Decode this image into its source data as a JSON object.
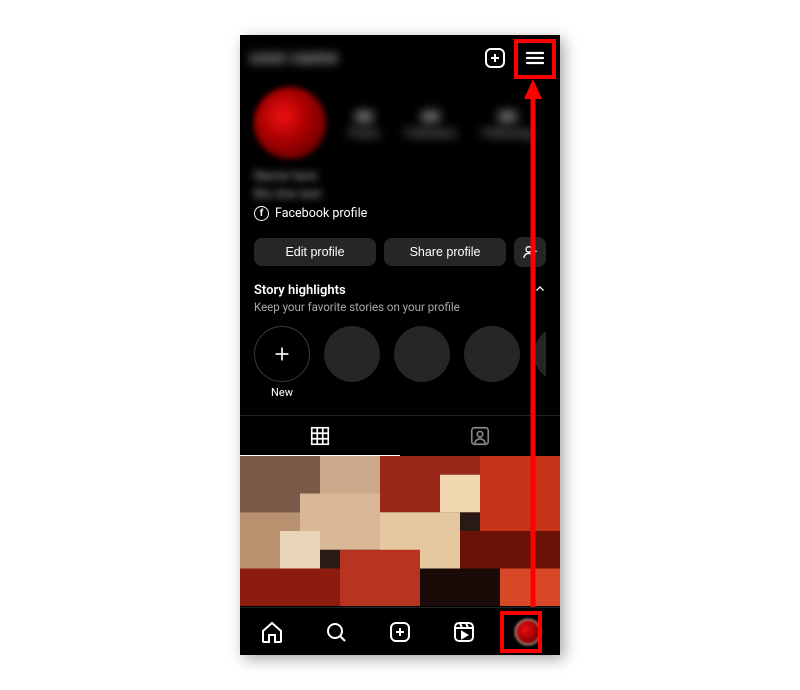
{
  "topbar": {
    "username_blurred": "user.name",
    "create_label": "Create",
    "menu_label": "Menu"
  },
  "stats": [
    {
      "n": "00",
      "l": "Posts"
    },
    {
      "n": "00",
      "l": "Followers"
    },
    {
      "n": "00",
      "l": "Following"
    }
  ],
  "bio": {
    "line1": "Name here",
    "line2": "Bio line text",
    "fb_label": "Facebook profile"
  },
  "buttons": {
    "edit": "Edit profile",
    "share": "Share profile",
    "discover": "Discover people"
  },
  "highlights": {
    "title": "Story highlights",
    "subtitle": "Keep your favorite stories on your profile",
    "new_label": "New"
  },
  "tabs": {
    "grid": "Posts grid",
    "tagged": "Tagged"
  },
  "nav": {
    "home": "Home",
    "search": "Search",
    "create": "Create",
    "reels": "Reels",
    "profile": "Profile"
  }
}
